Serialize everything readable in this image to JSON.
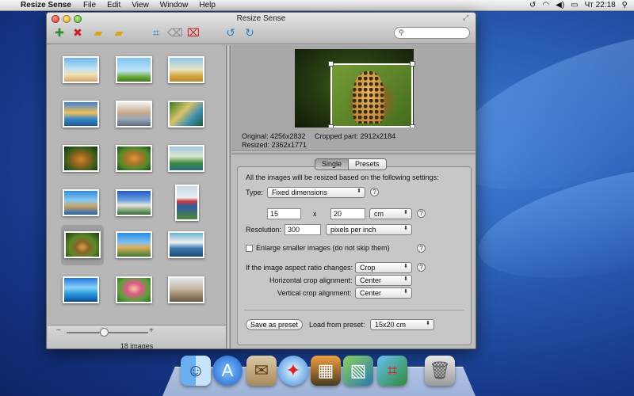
{
  "menubar": {
    "app_name": "Resize Sense",
    "items": [
      "File",
      "Edit",
      "View",
      "Window",
      "Help"
    ],
    "clock": "Чт 22:18"
  },
  "window": {
    "title": "Resize Sense",
    "search_placeholder": ""
  },
  "toolbar": {
    "icons": [
      "add-images-icon",
      "remove-images-icon",
      "open-folder-icon",
      "export-folder-icon",
      "crop-icon",
      "clear-crop-icon",
      "remove-crop-icon",
      "rotate-left-icon",
      "rotate-right-icon"
    ]
  },
  "thumbnails": {
    "count_label": "18 images",
    "selected_index": 12
  },
  "preview": {
    "original": "Original: 4256x2832",
    "resized": "Resized: 2362x1771",
    "cropped": "Cropped part: 2912x2184"
  },
  "settings": {
    "tabs": [
      "Single",
      "Presets"
    ],
    "active_tab": "Single",
    "intro": "All the images will be resized based on the following settings:",
    "type_label": "Type:",
    "type_value": "Fixed dimensions",
    "width_value": "15",
    "times": "x",
    "height_value": "20",
    "unit_value": "cm",
    "resolution_label": "Resolution:",
    "resolution_value": "300",
    "resolution_unit": "pixels per inch",
    "enlarge_label": "Enlarge smaller images (do not skip them)",
    "enlarge_checked": false,
    "aspect_label": "If the image aspect ratio changes:",
    "aspect_value": "Crop",
    "hcrop_label": "Horizontal crop alignment:",
    "hcrop_value": "Center",
    "vcrop_label": "Vertical crop alignment:",
    "vcrop_value": "Center",
    "save_preset": "Save as preset",
    "load_preset_label": "Load from preset:",
    "load_preset_value": "15x20 cm",
    "help": "?"
  },
  "dock": {
    "icons": [
      "finder-icon",
      "app-store-icon",
      "mail-stamp-icon",
      "safari-icon",
      "iphoto-icon",
      "image-viewer-icon",
      "resize-sense-icon",
      "trash-icon"
    ]
  }
}
